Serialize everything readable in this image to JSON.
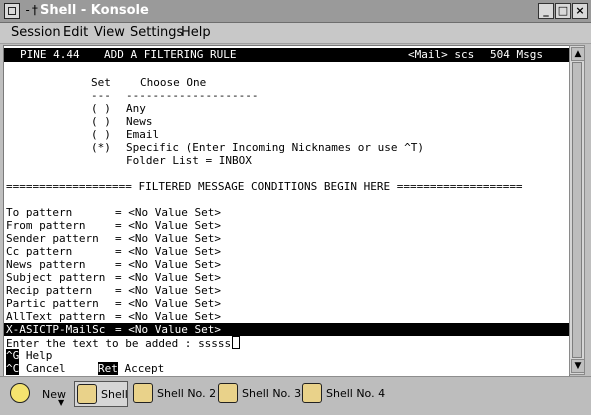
{
  "window": {
    "pin": "-†",
    "title": "Shell - Konsole",
    "buttons": {
      "minimize": "_",
      "maximize": "□",
      "close": "×"
    }
  },
  "menu": [
    "Session",
    "Edit",
    "View",
    "Settings",
    "Help"
  ],
  "pine_header": {
    "app": "PINE 4.44",
    "screen": "ADD A FILTERING RULE",
    "folder": "<Mail> scs",
    "count": "504 Msgs"
  },
  "set_section": {
    "set_label": "Set",
    "choose_label": "Choose One",
    "set_rule": "---",
    "choose_rule": "--------------------",
    "options": [
      {
        "mark": "( )",
        "label": "Any"
      },
      {
        "mark": "( )",
        "label": "News"
      },
      {
        "mark": "( )",
        "label": "Email"
      },
      {
        "mark": "(*)",
        "label": "Specific (Enter Incoming Nicknames or use ^T)"
      }
    ],
    "folder_list": "Folder List = INBOX"
  },
  "divider": "=================== FILTERED MESSAGE CONDITIONS BEGIN HERE ===================",
  "conditions": [
    {
      "name": "To pattern",
      "value": "= <No Value Set>"
    },
    {
      "name": "From pattern",
      "value": "= <No Value Set>"
    },
    {
      "name": "Sender pattern",
      "value": "= <No Value Set>"
    },
    {
      "name": "Cc pattern",
      "value": "= <No Value Set>"
    },
    {
      "name": "News pattern",
      "value": "= <No Value Set>"
    },
    {
      "name": "Subject pattern",
      "value": "= <No Value Set>"
    },
    {
      "name": "Recip pattern",
      "value": "= <No Value Set>"
    },
    {
      "name": "Partic pattern",
      "value": "= <No Value Set>"
    },
    {
      "name": "AllText pattern",
      "value": "= <No Value Set>"
    }
  ],
  "selected_condition": {
    "name": "X-ASICTP-MailSc",
    "value": "= <No Value Set>"
  },
  "prompt": {
    "text": "Enter the text to be added : ",
    "input": "sssss"
  },
  "keys": [
    {
      "key": "^G",
      "label": "Help"
    },
    {
      "key": "^C",
      "label": "Cancel"
    },
    {
      "key": "Ret",
      "label": "Accept"
    }
  ],
  "scrollbar": {
    "up": "▲",
    "down": "▼"
  },
  "taskbar": {
    "new_label": "New",
    "tabs": [
      "Shell",
      "Shell No. 2",
      "Shell No. 3",
      "Shell No. 4"
    ]
  }
}
